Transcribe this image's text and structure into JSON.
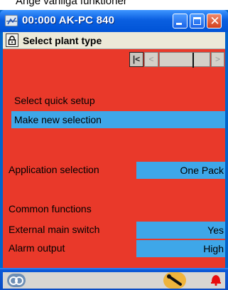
{
  "caption": "Ange vanliga funktioner",
  "window": {
    "title": "00:000 AK-PC 840"
  },
  "header": {
    "title": "Select plant type"
  },
  "nav": {
    "first": "|<",
    "prev": "<",
    "next": ">"
  },
  "quick_setup": {
    "label": "Select quick setup",
    "value": "Make new selection"
  },
  "application": {
    "label": "Application selection",
    "value": "One Pack"
  },
  "common": {
    "heading": "Common functions",
    "rows": [
      {
        "label": "External main switch",
        "value": "Yes"
      },
      {
        "label": "Alarm output",
        "value": "High"
      }
    ]
  },
  "status_icons": [
    "network-icon",
    "wrench-icon",
    "alarm-bell-icon"
  ],
  "colors": {
    "title_bar": "#0a5fe0",
    "content_bg": "#e9392a",
    "field_bg": "#3ea7e9",
    "close_button": "#d2401c"
  }
}
